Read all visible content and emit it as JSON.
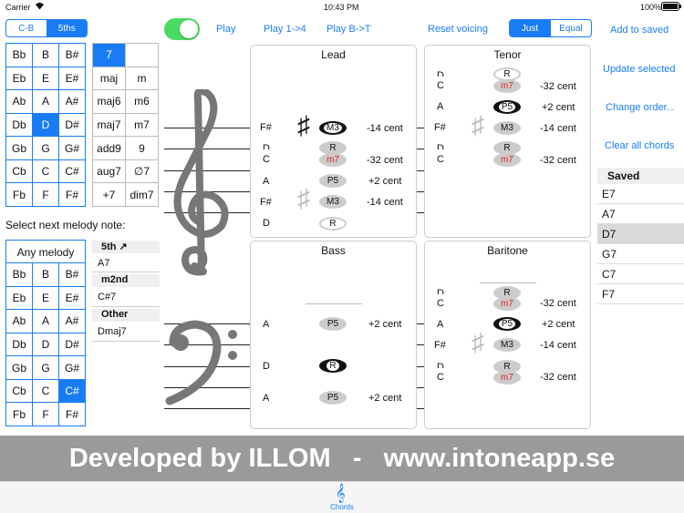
{
  "status_bar": {
    "carrier": "Carrier",
    "time": "10:43 PM",
    "battery": "100%"
  },
  "toolbar": {
    "order_seg": [
      "C-B",
      "5ths"
    ],
    "play_label": "Play",
    "play_1_4_label": "Play 1->4",
    "play_b_t_label": "Play B->T",
    "reset_label": "Reset voicing",
    "tuning_seg": [
      "Just",
      "Equal"
    ],
    "add_saved_label": "Add to saved"
  },
  "root_grid": [
    "Bb",
    "B",
    "B#",
    "Eb",
    "E",
    "E#",
    "Ab",
    "A",
    "A#",
    "Db",
    "D",
    "D#",
    "Gb",
    "G",
    "G#",
    "Cb",
    "C",
    "C#",
    "Fb",
    "F",
    "F#"
  ],
  "chord_types": [
    "7",
    "",
    "maj",
    "m",
    "maj6",
    "m6",
    "maj7",
    "m7",
    "add9",
    "9",
    "aug7",
    "∅7",
    "+7",
    "dim7"
  ],
  "melody": {
    "prompt": "Select next melody note:",
    "any_label": "Any melody",
    "grid": [
      "Bb",
      "B",
      "B#",
      "Eb",
      "E",
      "E#",
      "Ab",
      "A",
      "A#",
      "Db",
      "D",
      "D#",
      "Gb",
      "G",
      "G#",
      "Cb",
      "C",
      "C#",
      "Fb",
      "F",
      "F#"
    ]
  },
  "next_chords": {
    "cat1": "5th ↗",
    "cat1_items": [
      "A7"
    ],
    "cat2": "m2nd",
    "cat2_items": [
      "C#7"
    ],
    "cat3": "Other",
    "cat3_items": [
      "Dmaj7"
    ]
  },
  "panels": {
    "lead": {
      "title": "Lead"
    },
    "tenor": {
      "title": "Tenor"
    },
    "bass": {
      "title": "Bass"
    },
    "baritone": {
      "title": "Baritone"
    }
  },
  "notes": {
    "Fs": "F#",
    "D": "D",
    "C": "C",
    "A": "A",
    "M3": "M3",
    "R": "R",
    "m7": "m7",
    "P5": "P5",
    "c_m14": "-14 cent",
    "c_m32": "-32 cent",
    "c_p2": "+2 cent"
  },
  "side_actions": {
    "update": "Update selected",
    "change_order": "Change order...",
    "clear": "Clear all chords"
  },
  "saved": {
    "title": "Saved",
    "items": [
      "E7",
      "A7",
      "D7",
      "G7",
      "C7",
      "F7"
    ]
  },
  "banner_text": "Developed by ILLOM   -   www.intoneapp.se",
  "tab": {
    "label": "Chords"
  },
  "colors": {
    "accent": "#1a7cf5",
    "toggle": "#4cd964",
    "banner": "#9a9a9a"
  }
}
